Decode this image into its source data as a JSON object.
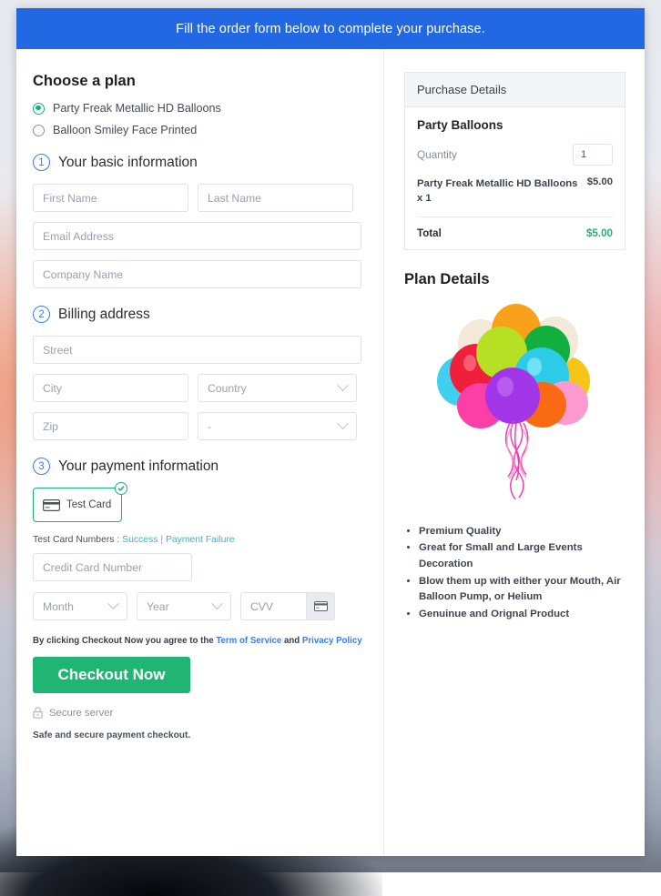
{
  "banner": {
    "text": "Fill the order form below to complete your purchase."
  },
  "plan": {
    "heading": "Choose a plan",
    "options": [
      {
        "label": "Party Freak Metallic HD Balloons",
        "selected": true
      },
      {
        "label": "Balloon Smiley Face Printed",
        "selected": false
      }
    ]
  },
  "steps": {
    "basic": {
      "number": "1",
      "title": "Your basic information"
    },
    "billing": {
      "number": "2",
      "title": "Billing address"
    },
    "payment": {
      "number": "3",
      "title": "Your payment information"
    }
  },
  "basic_fields": {
    "first_name": {
      "placeholder": "First Name",
      "value": ""
    },
    "last_name": {
      "placeholder": "Last Name",
      "value": ""
    },
    "email": {
      "placeholder": "Email Address",
      "value": ""
    },
    "company": {
      "placeholder": "Company Name",
      "value": ""
    }
  },
  "billing_fields": {
    "street": {
      "placeholder": "Street",
      "value": ""
    },
    "city": {
      "placeholder": "City",
      "value": ""
    },
    "country": {
      "placeholder": "Country",
      "value": "Country"
    },
    "zip": {
      "placeholder": "Zip",
      "value": ""
    },
    "state": {
      "placeholder": "-",
      "value": "-"
    }
  },
  "payment": {
    "method_tile": {
      "label": "Test  Card",
      "selected": true,
      "icon": "credit-card-icon",
      "badge_icon": "check-circle-icon"
    },
    "test_cards": {
      "prefix": "Test Card Numbers : ",
      "success_link": "Success",
      "separator": " | ",
      "failure_link": "Payment Failure"
    },
    "card_number": {
      "placeholder": "Credit Card Number",
      "value": ""
    },
    "month": {
      "placeholder": "Month",
      "value": "Month"
    },
    "year": {
      "placeholder": "Year",
      "value": "Year"
    },
    "cvv": {
      "placeholder": "CVV",
      "value": "",
      "hint_icon": "credit-card-icon"
    }
  },
  "footer": {
    "terms_prefix": "By clicking Checkout Now you agree to the ",
    "terms_link": "Term of Service",
    "terms_and": " and ",
    "privacy_link": "Privacy Policy",
    "checkout_label": "Checkout Now",
    "secure_label": "Secure server",
    "secure_icon": "lock-icon",
    "safe_note": "Safe and secure payment checkout."
  },
  "purchase_details": {
    "header": "Purchase Details",
    "product_title": "Party Balloons",
    "quantity_label": "Quantity",
    "quantity_value": "1",
    "line_item": {
      "name": "Party Freak Metallic HD Balloons x 1",
      "amount": "$5.00"
    },
    "total_label": "Total",
    "total_amount": "$5.00"
  },
  "plan_details": {
    "heading": "Plan Details",
    "image_alt": "balloon-bouquet-image",
    "bullets": [
      "Premium Quality",
      "Great for Small and Large Events Decoration",
      "Blow them up with either your Mouth, Air Balloon Pump, or Helium",
      "Genuinue and Orignal Product"
    ]
  },
  "colors": {
    "banner_blue": "#2268e3",
    "accent_green": "#21b573",
    "radio_green": "#17b07f",
    "link_blue": "#3b7ce8",
    "link_teal": "#34b6c6",
    "step_blue": "#3b7ce8"
  }
}
